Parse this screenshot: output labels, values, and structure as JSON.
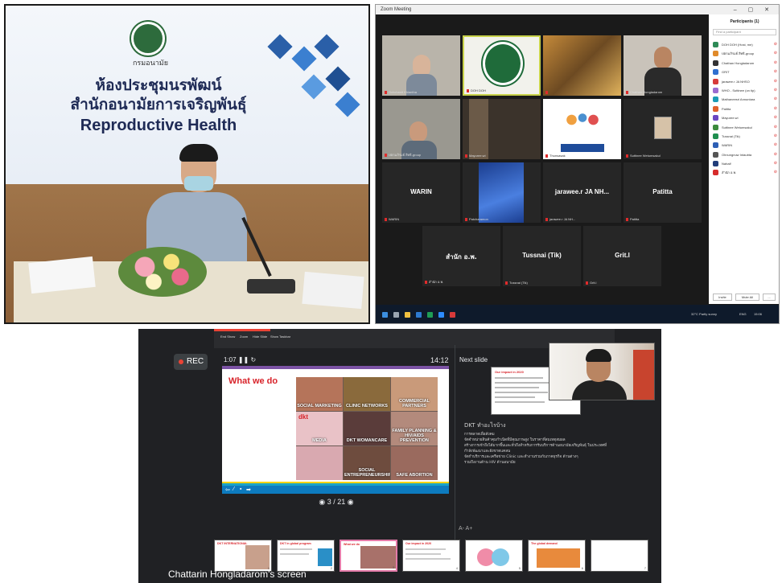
{
  "photo": {
    "logo_caption": "กรมอนามัย",
    "banner_line1": "ห้องประชุมนรพัฒน์",
    "banner_line2": "สำนักอนามัยการเจริญพันธุ์",
    "banner_line3": "Reproductive Health"
  },
  "zoom": {
    "window_title": "Zoom Meeting",
    "participants_title": "Participants (1)",
    "search_placeholder": "Find a participant",
    "tiles": [
      {
        "name": "",
        "caption": "Ochchanit Khiantha"
      },
      {
        "name": "",
        "caption": "DOH DOH"
      },
      {
        "name": "",
        "caption": ""
      },
      {
        "name": "",
        "caption": "Chathan Hongladarom"
      },
      {
        "name": "",
        "caption": "ปตกมภิรมย์ สิทธิ-group"
      },
      {
        "name": "",
        "caption": "Mayuree.wi"
      },
      {
        "name": "",
        "caption": "Thunsasak"
      },
      {
        "name": "",
        "caption": "Suttinee Wetumsakul"
      },
      {
        "name": "WARIN",
        "caption": "WARIN"
      },
      {
        "name": "",
        "caption": "Patcharamon"
      },
      {
        "name": "jarawee.r JA NH...",
        "caption": "jarawee.r JA NH..."
      },
      {
        "name": "Patitta",
        "caption": "Patitta"
      },
      {
        "name": "สำนัก อ.พ.",
        "caption": "สำนัก อ.พ."
      },
      {
        "name": "Tussnai (Tik)",
        "caption": "Tussnai (Tik)"
      },
      {
        "name": "Grit.l",
        "caption": "Grit.l"
      }
    ],
    "participants": [
      "DOH DOH (Host, me)",
      "ปตกมภิรมย์ สิทธิ-group",
      "Chathan Hongladarom",
      "GRIT",
      "jarawee.r JA NHSO",
      "WHO - Suttinee (on tip)",
      "Mathaneesri Annuntara",
      "Patitta",
      "Mayuree.wi",
      "Suttinee Wetumsakul",
      "Tussnai (Tik)",
      "WARIN",
      "Ohnungnuw Intaubta",
      "Nahalf",
      "สำนัก อ.พ."
    ],
    "invite_label": "Invite",
    "mute_all_label": "Mute All",
    "more_label": "...",
    "taskbar_weather": "32°C  Partly sunny",
    "taskbar_lang": "ENG",
    "taskbar_time": "15:06"
  },
  "presenter": {
    "rec_label": "REC",
    "toolbar_items": [
      "End Show",
      "Zoom",
      "Hide Slide",
      "Show Taskbar"
    ],
    "elapsed": "1:07",
    "clock": "14:12",
    "slide_title": "What we do",
    "slide_brand": "dkt",
    "slide_cells": [
      "SOCIAL MARKETING",
      "CLINIC NETWORKS",
      "COMMERCIAL PARTNERS",
      "MEDIA",
      "DKT WOMANCARE",
      "FAMILY PLANNING & HIV/AIDS PREVENTION",
      "",
      "SOCIAL ENTREPRENEURSHIP",
      "SAFE ABORTION"
    ],
    "pager": "3 / 21",
    "next_slide_label": "Next slide",
    "next_slide_title": "Our impact in 2020",
    "notes_heading": "DKT ทำอะไรบ้าง",
    "notes_lines": [
      "การตลาดเพื่อสังคม",
      "จัดจำหน่ายสินค้าคุมกำเนิดที่มีคุณภาพสูง ในราคาที่สมเหตุสมผล",
      "สร้างการเข้าถึงได้มากขึ้นและทั่วถึงสำหรับการรับบริการด้านอนามัยเจริญพันธุ์ ในประเทศที่",
      "กำลังพัฒนาและยังขาดแคลน",
      "จัดกำบริการและเครือข่าย Clinic และทำงานร่วมกับภาคธุรกิจ ด้านต่างๆ",
      "รวมถึงงานด้าน HIV ด้านอนามัย"
    ],
    "font_ctrl": "A-  A+",
    "thumb_titles": [
      "DKT INTERNATIONAL",
      "DKT in global program",
      "What we do",
      "Our impact in 2020",
      "",
      "The global demand",
      ""
    ],
    "thumb_numbers": [
      "1",
      "2",
      "3",
      "4",
      "5",
      "6",
      "7"
    ],
    "screen_caption": "Chattarin Hongladarom's screen"
  },
  "colors": {
    "rec_red": "#ea4335",
    "slide_red": "#d8232a",
    "slide_band": "#1aa3c7",
    "zoom_bg": "#1a1a1a"
  }
}
